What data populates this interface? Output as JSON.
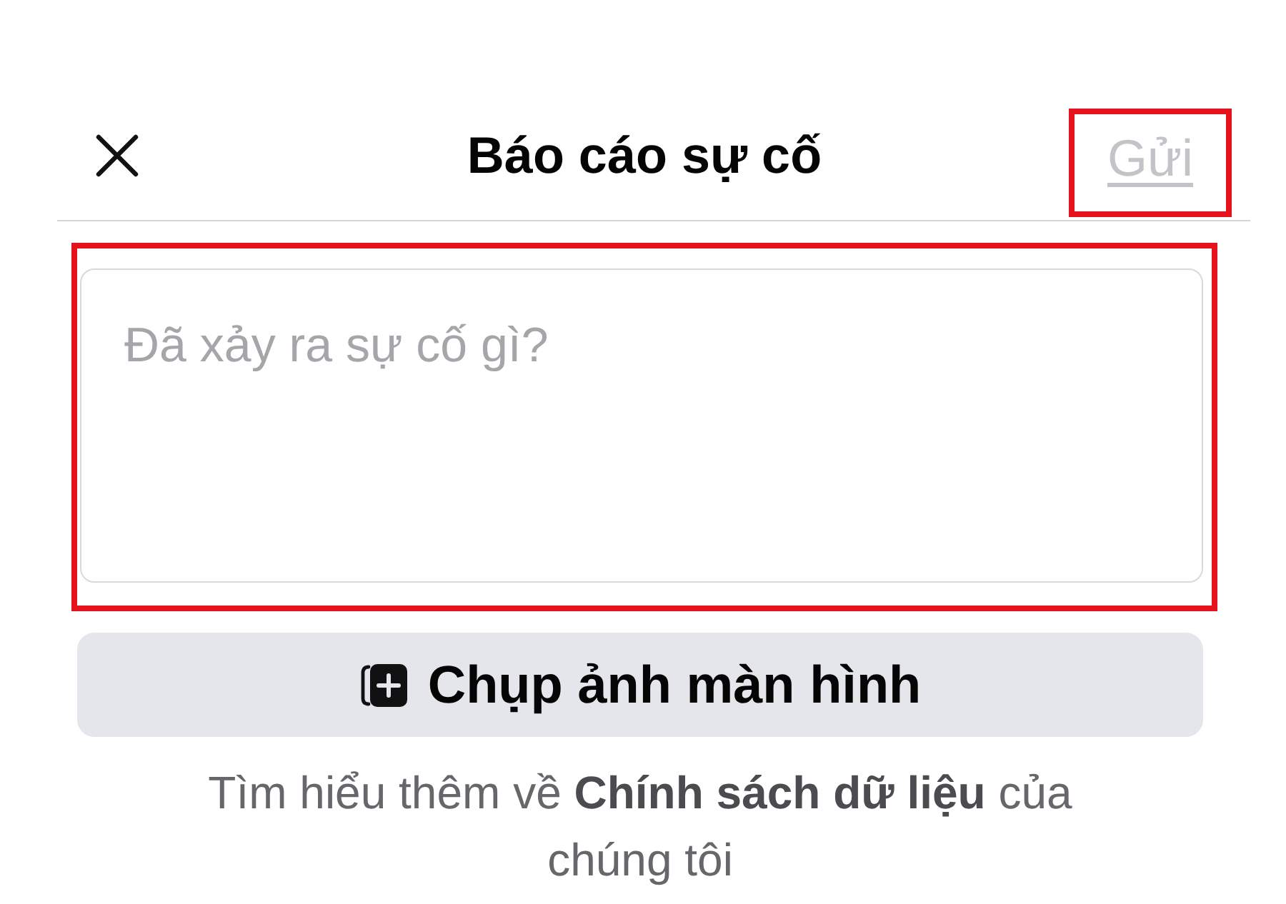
{
  "header": {
    "title": "Báo cáo sự cố",
    "send_button": {
      "label": "Gửi",
      "disabled": true,
      "highlighted": true
    }
  },
  "description_field": {
    "placeholder": "Đã xảy ra sự cố gì?",
    "highlighted": true
  },
  "screenshot_button": {
    "label": "Chụp ảnh màn hình"
  },
  "footer_note": "Tìm hiểu thêm về **Chính sách dữ liệu** của chúng tôi"
}
